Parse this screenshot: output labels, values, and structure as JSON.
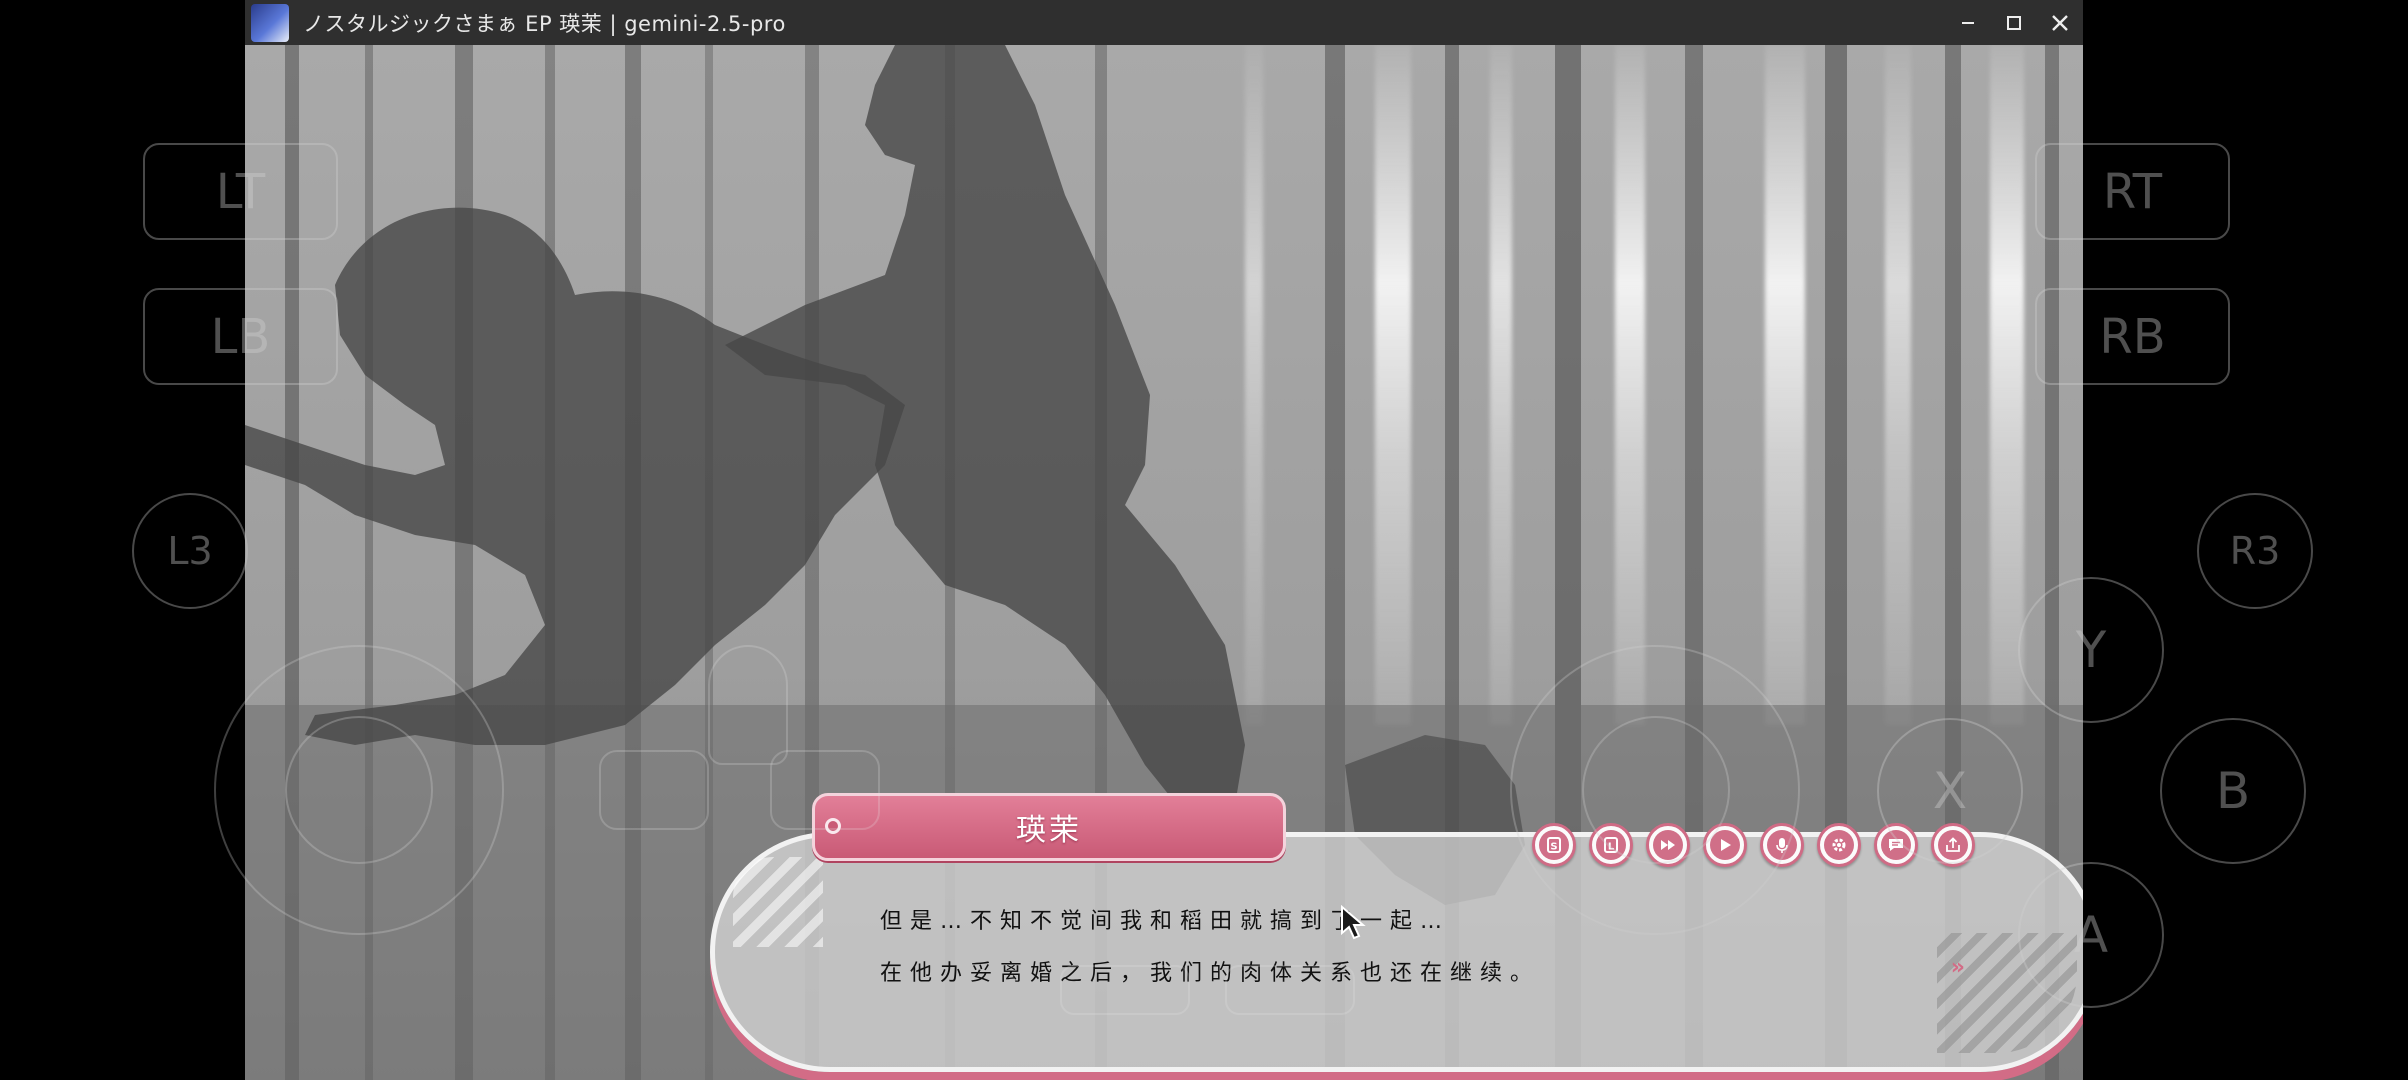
{
  "window": {
    "title": "ノスタルジックさまぁ EP 瑛茉 | gemini-2.5-pro",
    "controls": [
      "minimize",
      "maximize",
      "close"
    ]
  },
  "dialogue": {
    "speaker": "瑛茉",
    "line1": "但是…不知不觉间我和稻田就搞到了一起…",
    "line2": "在他办妥离婚之后，我们的肉体关系也还在继续。",
    "next_indicator": "»"
  },
  "toolbar": [
    {
      "name": "save",
      "icon": "save-icon"
    },
    {
      "name": "load",
      "icon": "load-icon"
    },
    {
      "name": "skip",
      "icon": "fast-forward-icon"
    },
    {
      "name": "auto",
      "icon": "play-icon"
    },
    {
      "name": "voice",
      "icon": "microphone-icon"
    },
    {
      "name": "config",
      "icon": "gear-icon"
    },
    {
      "name": "log",
      "icon": "message-icon"
    },
    {
      "name": "share",
      "icon": "share-icon"
    }
  ],
  "gamepad": {
    "LT": "LT",
    "RT": "RT",
    "LB": "LB",
    "RB": "RB",
    "L3": "L3",
    "R3": "R3",
    "Y": "Y",
    "X": "X",
    "B": "B",
    "A": "A"
  },
  "colors": {
    "accent_pink": "#cf6b85",
    "namebar": "#d96c88",
    "titlebar": "#2f2f2f"
  }
}
